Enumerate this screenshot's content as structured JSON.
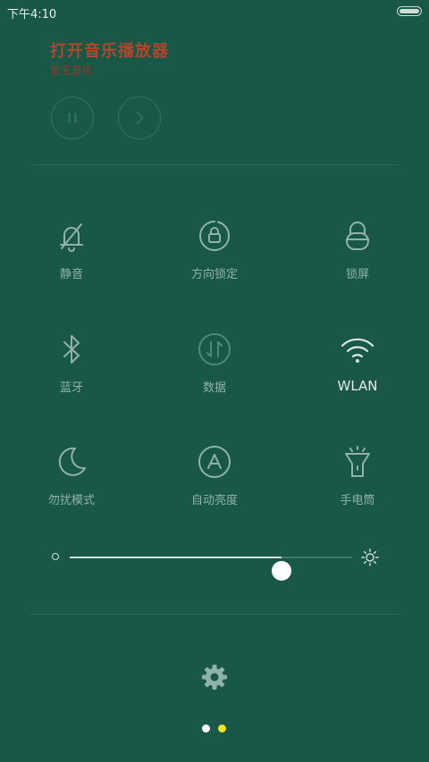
{
  "status_bar": {
    "time": "下午4:10"
  },
  "music": {
    "title": "打开音乐播放器",
    "subtitle": "暂无音乐",
    "title_color": "#b3452c"
  },
  "tiles": [
    {
      "label": "静音",
      "icon": "bell-off-icon",
      "active": false
    },
    {
      "label": "方向锁定",
      "icon": "rotation-lock-icon",
      "active": false
    },
    {
      "label": "锁屏",
      "icon": "lock-icon",
      "active": false
    },
    {
      "label": "蓝牙",
      "icon": "bluetooth-icon",
      "active": false
    },
    {
      "label": "数据",
      "icon": "mobile-data-icon",
      "active": false
    },
    {
      "label": "WLAN",
      "icon": "wifi-icon",
      "active": true
    },
    {
      "label": "勿扰模式",
      "icon": "moon-icon",
      "active": false
    },
    {
      "label": "自动亮度",
      "icon": "auto-brightness-icon",
      "active": false
    },
    {
      "label": "手电筒",
      "icon": "flashlight-icon",
      "active": false
    }
  ],
  "brightness": {
    "level": 0.75
  },
  "pager": {
    "pages": 2,
    "current": 2,
    "active_color": "#f0e515",
    "inactive_color": "#ffffff"
  },
  "colors": {
    "background": "#195746",
    "icon": "#8fb3a8",
    "active": "#e4ece9"
  }
}
